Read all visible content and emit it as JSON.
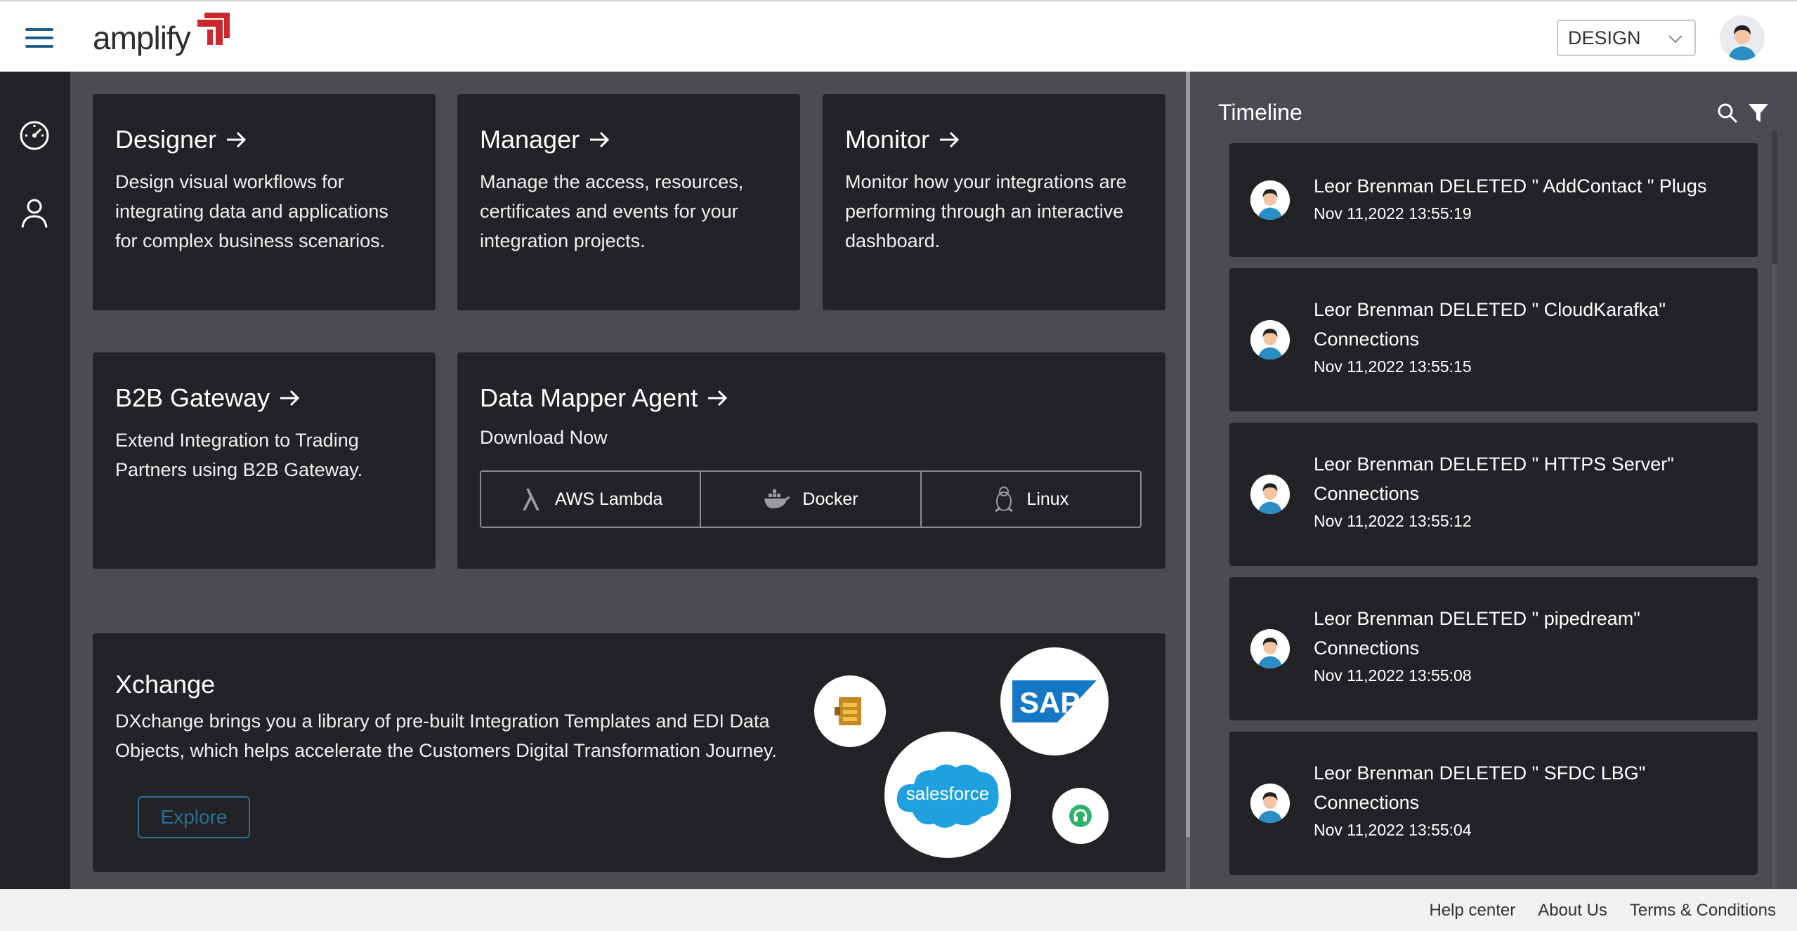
{
  "header": {
    "logo_text": "amplify",
    "mode_select": "DESIGN"
  },
  "rail": {
    "items": [
      {
        "icon": "dashboard-gauge-icon"
      },
      {
        "icon": "user-icon"
      }
    ]
  },
  "cards": {
    "designer": {
      "title": "Designer",
      "desc": "Design visual workflows for integrating data and applications for complex business scenarios."
    },
    "manager": {
      "title": "Manager",
      "desc": "Manage the access, resources, certificates and events for your integration projects."
    },
    "monitor": {
      "title": "Monitor",
      "desc": "Monitor how your integrations are performing through an interactive dashboard."
    },
    "b2b": {
      "title": "B2B Gateway",
      "desc": "Extend Integration to Trading Partners using B2B Gateway."
    },
    "mapper": {
      "title": "Data Mapper Agent",
      "subtitle": "Download Now",
      "buttons": [
        "AWS Lambda",
        "Docker",
        "Linux"
      ]
    },
    "xchange": {
      "title": "Xchange",
      "desc": "DXchange brings you a library of pre-built Integration Templates and EDI Data Objects, which helps accelerate the Customers Digital Transformation Journey.",
      "explore": "Explore",
      "logos": {
        "sap": "SAP",
        "salesforce": "salesforce"
      }
    }
  },
  "timeline": {
    "title": "Timeline",
    "items": [
      {
        "line1": "Leor Brenman DELETED \" AddContact \" Plugs",
        "line2": "",
        "time": "Nov 11,2022   13:55:19"
      },
      {
        "line1": "Leor Brenman DELETED \" CloudKarafka\"",
        "line2": "Connections",
        "time": "Nov 11,2022   13:55:15"
      },
      {
        "line1": "Leor Brenman DELETED \" HTTPS Server\"",
        "line2": "Connections",
        "time": "Nov 11,2022   13:55:12"
      },
      {
        "line1": "Leor Brenman DELETED \" pipedream\"",
        "line2": "Connections",
        "time": "Nov 11,2022   13:55:08"
      },
      {
        "line1": "Leor Brenman DELETED \" SFDC LBG\"",
        "line2": "Connections",
        "time": "Nov 11,2022   13:55:04"
      }
    ]
  },
  "footer": {
    "links": [
      "Help center",
      "About Us",
      "Terms & Conditions"
    ]
  },
  "colors": {
    "accent": "#1e5d88",
    "brand_red": "#c8282e",
    "card_bg": "#222326",
    "page_bg": "#4a4c52"
  }
}
